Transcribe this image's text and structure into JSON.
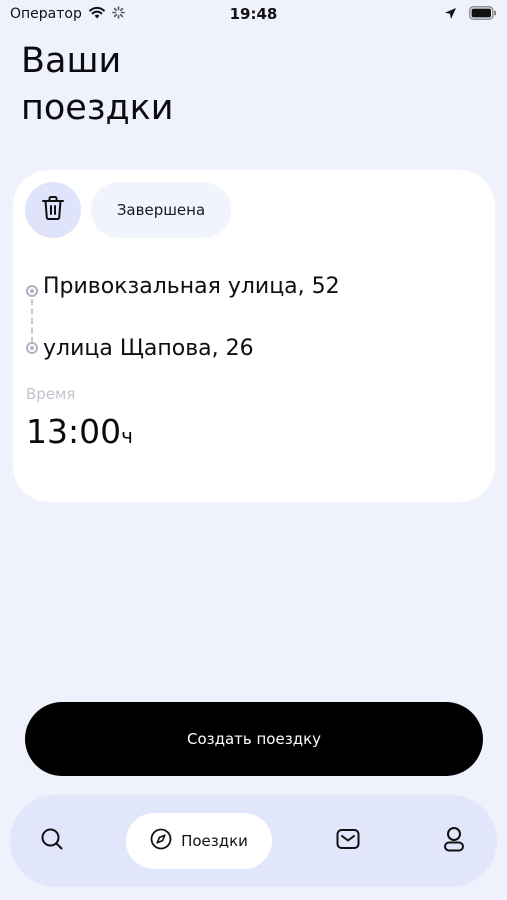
{
  "status_bar": {
    "carrier": "Оператор",
    "time": "19:48",
    "icons": [
      "wifi-icon",
      "loading-icon",
      "location-arrow-icon",
      "battery-icon"
    ]
  },
  "page": {
    "title_line1": "Ваши",
    "title_line2": "поездки"
  },
  "trip": {
    "status": "Завершена",
    "delete_icon": "trash-icon",
    "from_address": "Привокзальная улица, 52",
    "to_address": "улица Щапова, 26",
    "time_label": "Время",
    "time_value": "13:00",
    "time_unit": "ч"
  },
  "actions": {
    "create_trip_label": "Создать поездку"
  },
  "tab_bar": {
    "tabs": [
      {
        "icon": "search-icon",
        "label": ""
      },
      {
        "icon": "compass-icon",
        "label": "Поездки",
        "active": true
      },
      {
        "icon": "mail-icon",
        "label": ""
      },
      {
        "icon": "profile-icon",
        "label": ""
      }
    ]
  },
  "colors": {
    "background": "#eff1fd",
    "card": "#ffffff",
    "accent_light": "#dfe4fb",
    "button": "#000000",
    "tab_bar": "#e2e6fb"
  }
}
